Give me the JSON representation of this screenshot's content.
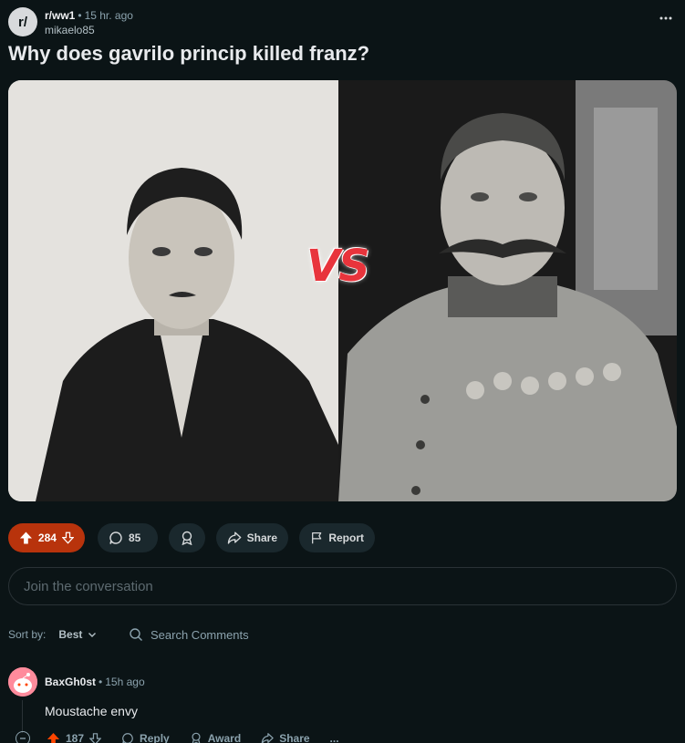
{
  "post": {
    "subreddit": "r/ww1",
    "subreddit_icon_text": "r/",
    "time": "15 hr. ago",
    "author": "mikaelo85",
    "title": "Why does gavrilo princip killed franz?",
    "image_overlay_text": "VS",
    "icons": {
      "more": "ellipsis-icon",
      "upvote": "upvote-arrow-icon",
      "downvote": "downvote-arrow-icon",
      "comments": "comment-bubble-icon",
      "award": "award-icon",
      "share": "share-arrow-icon",
      "report": "flag-icon"
    }
  },
  "actions": {
    "votes": "284",
    "comments": "85",
    "share_label": "Share",
    "report_label": "Report"
  },
  "join": {
    "placeholder": "Join the conversation"
  },
  "sort": {
    "label": "Sort by:",
    "value": "Best",
    "search_placeholder": "Search Comments"
  },
  "comments": [
    {
      "author": "BaxGh0st",
      "time": "15h ago",
      "body": "Moustache envy",
      "votes": "187",
      "reply_label": "Reply",
      "award_label": "Award",
      "share_label": "Share",
      "more_label": "..."
    }
  ],
  "colors": {
    "background": "#0b1416",
    "upvoted": "#b8330c",
    "pill": "#1a282d",
    "vs_red": "#e8343c"
  }
}
